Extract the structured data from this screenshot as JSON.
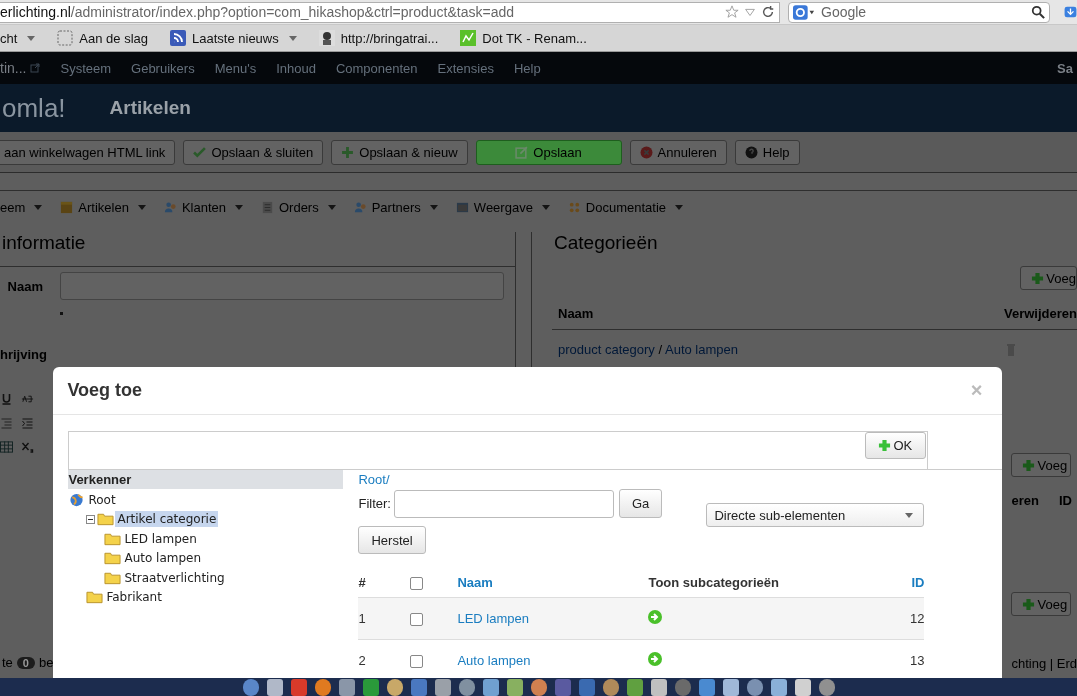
{
  "browser": {
    "url_host": "erlichting.nl",
    "url_path": "/administrator/index.php?option=com_hikashop&ctrl=product&task=add",
    "search_placeholder": "Google",
    "bookmarks": [
      {
        "label": "cht",
        "kind": "folder",
        "menu": true
      },
      {
        "label": "Aan de slag",
        "kind": "page",
        "menu": false
      },
      {
        "label": "Laatste nieuws",
        "kind": "feed",
        "menu": true
      },
      {
        "label": "http://bringatrai...",
        "kind": "site",
        "menu": false
      },
      {
        "label": "Dot TK - Renam...",
        "kind": "green",
        "menu": false
      }
    ]
  },
  "admin": {
    "site_title": "tin...",
    "menu": [
      "Systeem",
      "Gebruikers",
      "Menu's",
      "Inhoud",
      "Componenten",
      "Extensies",
      "Help"
    ],
    "user": "Sa",
    "logo": "omla!",
    "page_title": "Artikelen",
    "toolbar": [
      {
        "label": "aan winkelwagen HTML link",
        "kind": "plain"
      },
      {
        "label": "Opslaan & sluiten",
        "kind": "check"
      },
      {
        "label": "Opslaan & nieuw",
        "kind": "plus"
      },
      {
        "label": "Opslaan",
        "kind": "primary"
      },
      {
        "label": "Annuleren",
        "kind": "cancel"
      },
      {
        "label": "Help",
        "kind": "help"
      }
    ],
    "submenu": [
      {
        "label": "eem",
        "kind": "none"
      },
      {
        "label": "Artikelen",
        "kind": "book"
      },
      {
        "label": "Klanten",
        "kind": "people"
      },
      {
        "label": "Orders",
        "kind": "list"
      },
      {
        "label": "Partners",
        "kind": "people"
      },
      {
        "label": "Weergave",
        "kind": "window"
      },
      {
        "label": "Documentatie",
        "kind": "dots"
      }
    ],
    "info_panel": {
      "title": "informatie",
      "name_label": "Naam",
      "desc_label": "hrijving"
    },
    "categories_panel": {
      "title": "Categorieën",
      "add_button": "Voeg",
      "columns": [
        "Naam",
        "Verwijderen"
      ],
      "rows": [
        {
          "path": "product category",
          "separator": "/",
          "name": "Auto lampen"
        }
      ]
    },
    "left_edge": {
      "status_text": "te",
      "badge": "0",
      "status_after": "be"
    },
    "right_edge": {
      "add_button": "Voeg",
      "columns": [
        "eren",
        "ID"
      ],
      "add_button_2": "Voeg",
      "footer": "chting | Erd"
    }
  },
  "modal": {
    "title": "Voeg toe",
    "close": "×",
    "ok_button": "OK",
    "explorer_title": "Verkenner",
    "tree": [
      {
        "label": "Root",
        "kind": "root",
        "selected": false,
        "children": [
          {
            "label": "Artikel categorie",
            "kind": "folder",
            "selected": true,
            "expanded": true,
            "children": [
              {
                "label": "LED lampen",
                "kind": "folder",
                "selected": false
              },
              {
                "label": "Auto lampen",
                "kind": "folder",
                "selected": false
              },
              {
                "label": "Straatverlichting",
                "kind": "folder",
                "selected": false
              }
            ]
          },
          {
            "label": "Fabrikant",
            "kind": "folder",
            "selected": false
          }
        ]
      }
    ],
    "breadcrumb": "Root/",
    "filter_label": "Filter:",
    "filter_button": "Ga",
    "reset_button": "Herstel",
    "scope_select": "Directe sub-elementen",
    "columns": [
      "#",
      "Naam",
      "Toon subcategorieën",
      "ID"
    ],
    "all_checked": false,
    "rows": [
      {
        "number": "1",
        "name": "LED lampen",
        "id": "12",
        "checked": false
      },
      {
        "number": "2",
        "name": "Auto lampen",
        "id": "13",
        "checked": false
      }
    ]
  }
}
